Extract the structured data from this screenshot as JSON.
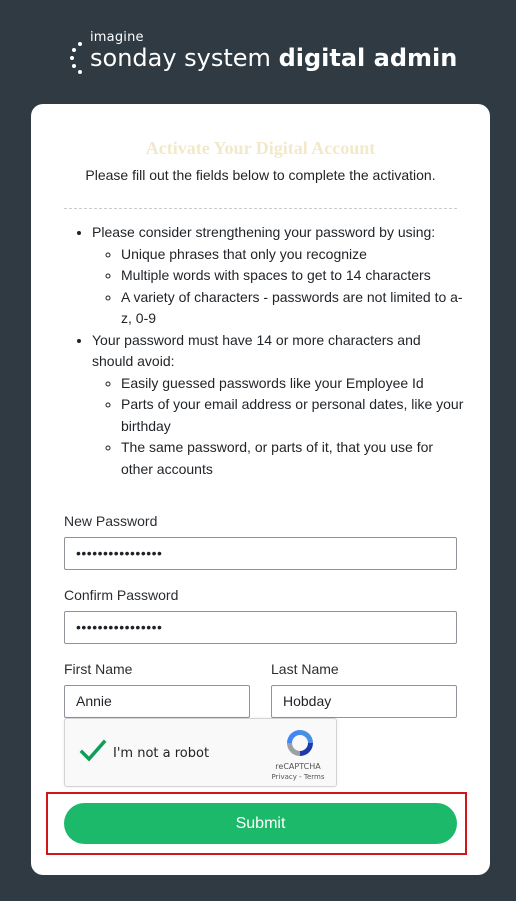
{
  "header": {
    "logo_small": "imagine",
    "logo_regular": "sonday system ",
    "logo_bold": "digital admin"
  },
  "form": {
    "title": "Activate Your Digital Account",
    "subtitle": "Please fill out the fields below to complete the activation.",
    "rules": [
      {
        "text": "Please consider strengthening your password by using:",
        "sub": [
          "Unique phrases that only you recognize",
          "Multiple words with spaces to get to 14 characters",
          "A variety of characters - passwords are not limited to a-z, 0-9"
        ]
      },
      {
        "text": "Your password must have 14 or more characters and should avoid:",
        "sub": [
          "Easily guessed passwords like your Employee Id",
          "Parts of your email address or personal dates, like your birthday",
          "The same password, or parts of it, that you use for other accounts"
        ]
      }
    ],
    "new_password": {
      "label": "New Password",
      "value": "••••••••••••••••"
    },
    "confirm_password": {
      "label": "Confirm Password",
      "value": "••••••••••••••••"
    },
    "first_name": {
      "label": "First Name",
      "value": "Annie"
    },
    "last_name": {
      "label": "Last Name",
      "value": "Hobday"
    },
    "captcha": {
      "label": "I'm not a robot",
      "brand": "reCAPTCHA",
      "links": "Privacy - Terms",
      "checked": true
    },
    "submit_label": "Submit"
  },
  "colors": {
    "background": "#2f3a43",
    "title": "#f1e9c9",
    "submit": "#1db96a",
    "highlight": "#d0151b"
  }
}
